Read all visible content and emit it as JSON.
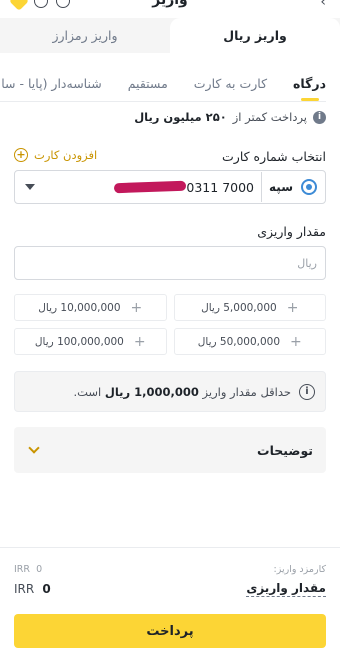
{
  "header": {
    "title": "واریز"
  },
  "segments": [
    {
      "label": "واریز ریال",
      "active": true
    },
    {
      "label": "واریز رمزارز",
      "active": false
    }
  ],
  "method_tabs": [
    {
      "label": "درگاه",
      "active": true
    },
    {
      "label": "کارت به کارت",
      "active": false
    },
    {
      "label": "مستقیم",
      "active": false
    },
    {
      "label": "شناسه‌دار (پایا - سا",
      "active": false
    }
  ],
  "limit_info": {
    "prefix": "پرداخت کمتر از",
    "amount": "۲۵۰ میلیون ریال"
  },
  "card": {
    "label": "انتخاب شماره کارت",
    "add_label": "افزودن کارت",
    "bank_name": "سپه",
    "number_visible": "0311 7000"
  },
  "amount": {
    "label": "مقدار واریزی",
    "placeholder": "ریال"
  },
  "quick_amounts": [
    {
      "value": "5,000,000",
      "unit": "ریال"
    },
    {
      "value": "10,000,000",
      "unit": "ریال"
    },
    {
      "value": "50,000,000",
      "unit": "ریال"
    },
    {
      "value": "100,000,000",
      "unit": "ریال"
    }
  ],
  "min_notice": {
    "prefix": "حداقل مقدار واریز",
    "amount": "1,000,000 ریال",
    "suffix": "است."
  },
  "description": {
    "label": "توضیحات"
  },
  "footer": {
    "fee_label": "کارمزد واریز:",
    "fee_value": "0",
    "fee_currency": "IRR",
    "amount_label": "مقدار واریزی",
    "amount_value": "0",
    "amount_currency": "IRR",
    "pay_label": "پرداخت"
  },
  "colors": {
    "accent": "#fcd535",
    "accent_text": "#c99400",
    "redaction": "#c2185b"
  }
}
